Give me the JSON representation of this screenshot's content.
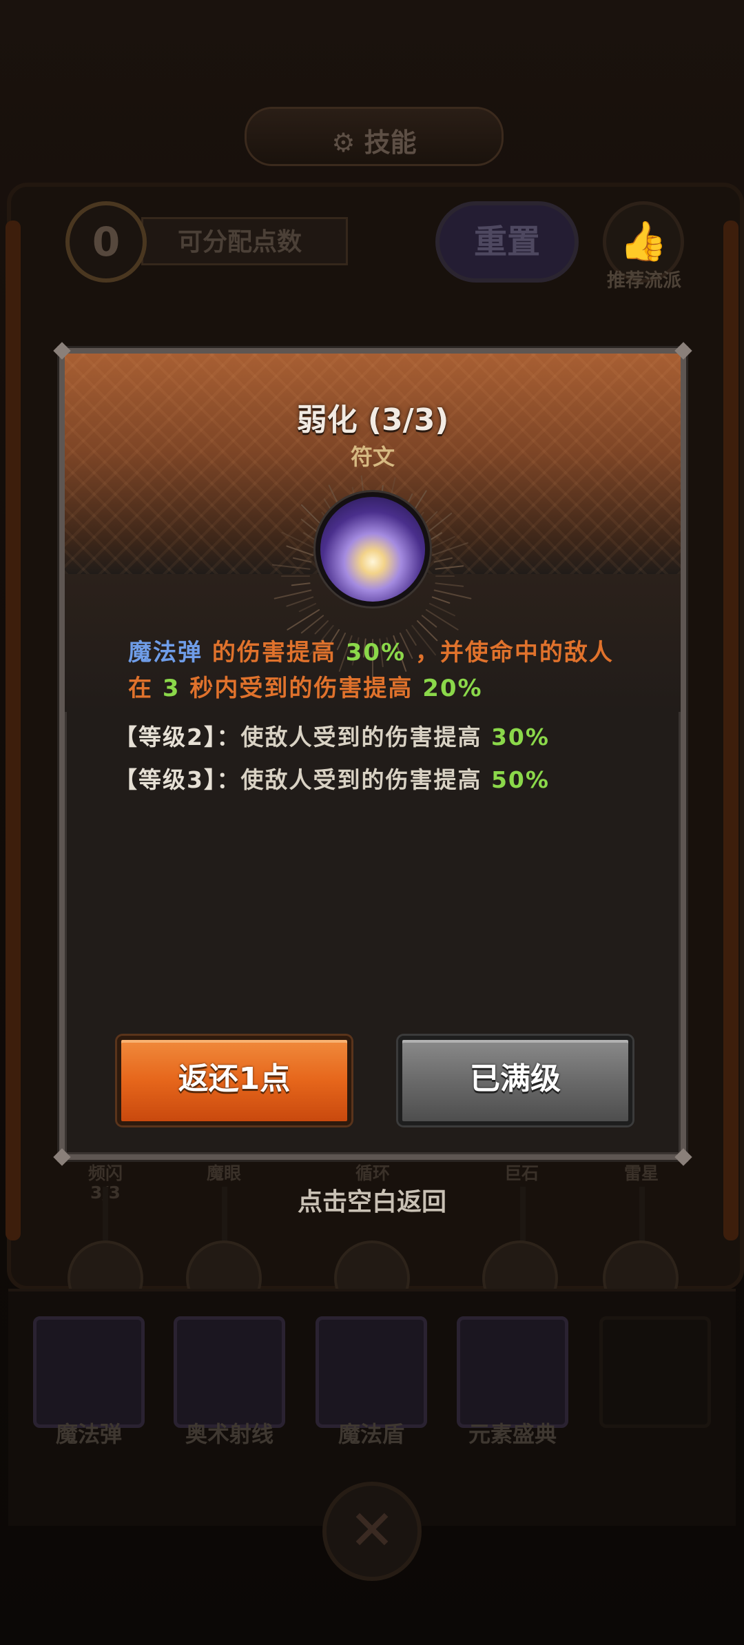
{
  "header": {
    "title": "技能",
    "title_icon": "gear-icon"
  },
  "points": {
    "value": "0",
    "label": "可分配点数"
  },
  "reset_label": "重置",
  "recommend": {
    "icon": "thumbs-up-icon",
    "label": "推荐流派"
  },
  "tree_nodes": [
    {
      "label": "频闪",
      "counter": "3/3"
    },
    {
      "label": "魔眼"
    },
    {
      "label": "循环"
    },
    {
      "label": "巨石"
    },
    {
      "label": "雷星"
    }
  ],
  "back_hint": "点击空白返回",
  "skills": [
    "魔法弹",
    "奥术射线",
    "魔法盾",
    "元素盛典"
  ],
  "modal": {
    "title": "弱化 (3/3)",
    "subtitle": "符文",
    "icon": "magic-bolt-icon",
    "desc": {
      "skill": "魔法弹",
      "p1": " 的伤害提高 ",
      "v1": "30%",
      "p2": " ，并使命中的敌人在 ",
      "v2": "3",
      "p3": " 秒内受到的伤害提高 ",
      "v3": "20%"
    },
    "levels": [
      {
        "tag": "【等级2】：",
        "text": "使敌人受到的伤害提高 ",
        "value": "30%"
      },
      {
        "tag": "【等级3】：",
        "text": "使敌人受到的伤害提高 ",
        "value": "50%"
      }
    ],
    "refund_label": "返还1点",
    "maxed_label": "已满级"
  },
  "colors": {
    "skill_name": "#6f9de8",
    "desc_text": "#e0722c",
    "value_highlight": "#8bd84a",
    "refund_button": "#e6661b",
    "maxed_button": "#6a6a6a"
  }
}
